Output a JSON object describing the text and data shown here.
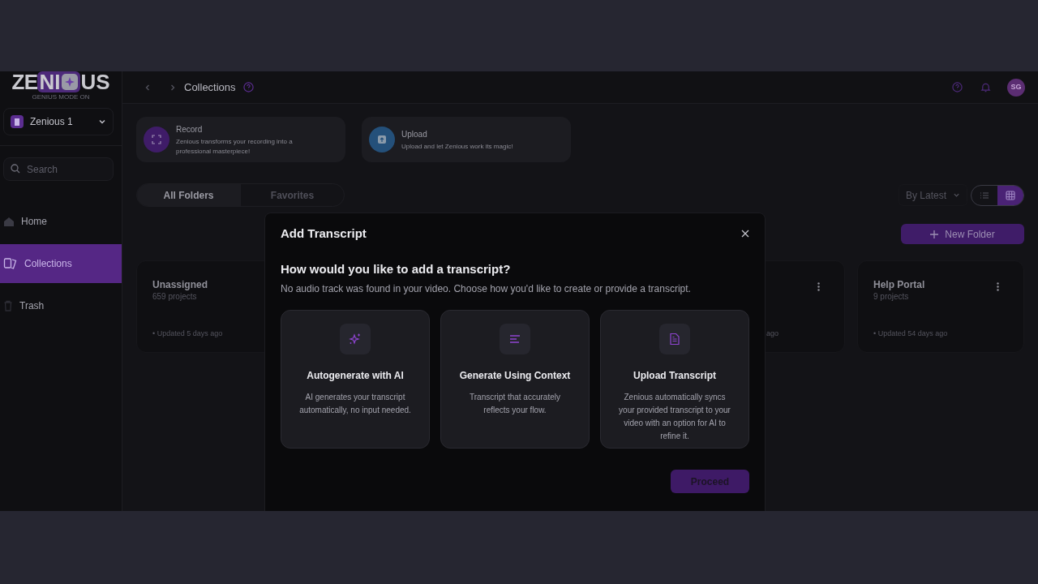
{
  "logo": {
    "left": "ZE",
    "highlight": "NI",
    "right": "US",
    "tagline": "GENIUS MODE ON"
  },
  "workspace": {
    "name": "Zenious 1"
  },
  "search": {
    "placeholder": "Search"
  },
  "nav": [
    {
      "label": "Home",
      "kind": "home",
      "selected": false
    },
    {
      "label": "Collections",
      "kind": "collections",
      "selected": true
    },
    {
      "label": "Trash",
      "kind": "trash",
      "selected": false
    }
  ],
  "header": {
    "title": "Collections",
    "avatar": "SG"
  },
  "actions": [
    {
      "kind": "record",
      "title": "Record",
      "text": "Zenious transforms your recording into a professional masterpiece!"
    },
    {
      "kind": "upload",
      "title": "Upload",
      "text": "Upload and let Zenious work its magic!"
    }
  ],
  "tabs": [
    {
      "label": "All Folders",
      "selected": true
    },
    {
      "label": "Favorites",
      "selected": false
    }
  ],
  "sort": {
    "value": "By Latest"
  },
  "view_toggle": [
    {
      "kind": "list",
      "selected": false
    },
    {
      "kind": "grid",
      "selected": true
    }
  ],
  "new_folder": {
    "label": "New Folder"
  },
  "folders": [
    {
      "kind": "full",
      "name": "Unassigned",
      "count": "659 projects",
      "updated": "• Updated 5 days ago"
    },
    {
      "kind": "partial",
      "updated": "ago"
    },
    {
      "kind": "full",
      "name": "Help Portal",
      "count": "9 projects",
      "updated": "• Updated 54 days ago"
    }
  ],
  "modal": {
    "title": "Add Transcript",
    "question": "How would you like to add a transcript?",
    "description": "No audio track was found in your video. Choose how you'd like to create or provide a transcript.",
    "options": [
      {
        "kind": "ai",
        "title": "Autogenerate with AI",
        "text": "AI generates your transcript automatically, no input needed.",
        "selected": false
      },
      {
        "kind": "context",
        "title": "Generate Using Context",
        "text": "Transcript that accurately reflects your flow.",
        "selected": false
      },
      {
        "kind": "upload",
        "title": "Upload Transcript",
        "text": "Zenious automatically syncs your provided transcript to your video with an option for AI to refine it.",
        "selected": false
      }
    ],
    "proceed": {
      "label": "Proceed",
      "disabled": true
    }
  }
}
